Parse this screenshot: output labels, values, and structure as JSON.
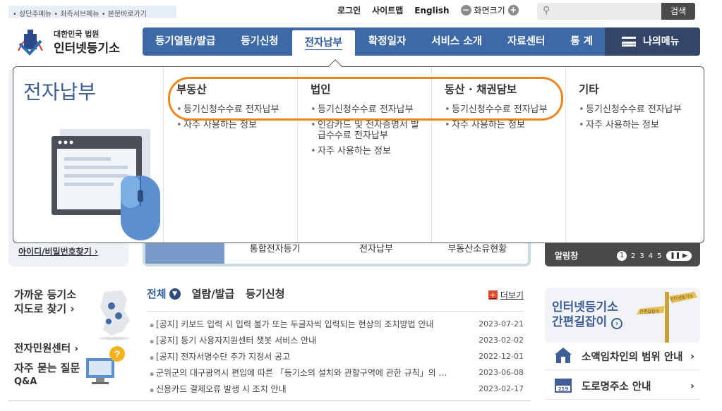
{
  "skip_links": "• 상단주메뉴  • 좌측서브메뉴  • 본문바로가기",
  "util": {
    "login": "로그인",
    "sitemap": "사이트맵",
    "english": "English",
    "zoom_label": "화면크기",
    "minus": "−",
    "plus": "+"
  },
  "search": {
    "button": "검색"
  },
  "logo": {
    "line1": "대한민국 법원",
    "line2": "인터넷등기소"
  },
  "nav": {
    "items": [
      "등기열람/발급",
      "등기신청",
      "전자납부",
      "확정일자",
      "서비스 소개",
      "자료센터",
      "통 계"
    ],
    "my_menu": "나의메뉴"
  },
  "panel": {
    "title": "전자납부",
    "cols": [
      {
        "head": "부동산",
        "items": [
          "등기신청수수료 전자납부",
          "자주 사용하는 정보"
        ]
      },
      {
        "head": "법인",
        "items": [
          "등기신청수수료 전자납부",
          "인감카드 및 전자증명서 발급수수료 전자납부",
          "자주 사용하는 정보"
        ]
      },
      {
        "head": "동산 · 채권담보",
        "items": [
          "등기신청수수료 전자납부",
          "자주 사용하는 정보"
        ]
      },
      {
        "head": "기타",
        "items": [
          "등기신청수수료 전자납부",
          "자주 사용하는 정보"
        ]
      }
    ]
  },
  "under": {
    "find_id": "아이디/비밀번호찾기 ›"
  },
  "midbox": {
    "tabs": [
      "통합전자등기",
      "전자납부",
      "부동산소유현황"
    ]
  },
  "notice": {
    "title": "알림창",
    "pages": [
      "1",
      "2",
      "3",
      "4",
      "5"
    ]
  },
  "near": {
    "line1": "가까운 등기소",
    "line2": "지도로 찾기 ›"
  },
  "cc": {
    "line1": "전자민원센터 ›",
    "faq": "자주 묻는 질문",
    "qa": "Q&A"
  },
  "news": {
    "tabs": [
      "전체",
      "열람/발급",
      "등기신청"
    ],
    "more": "더보기",
    "items": [
      {
        "title": "[공지] 키보드 입력 시 입력 불가 또는 두글자씩 입력되는 현상의 조치방법 안내",
        "date": "2023-07-21"
      },
      {
        "title": "[공지] 등기 사용자지원센터 챗봇 서비스 안내",
        "date": "2023-02-02"
      },
      {
        "title": "[공지] 전자서명수단 추가 지정서 공고",
        "date": "2022-12-01"
      },
      {
        "title": "군위군의 대구광역시 편입에 따른 「등기소의 설치와 관할구역에 관한 규칙」의 …",
        "date": "2023-06-08"
      },
      {
        "title": "신용카드 결제오류 발생 시 조치 안내",
        "date": "2023-02-17"
      }
    ]
  },
  "right": {
    "easy1": "인터넷등기소",
    "easy2": "간편길잡이",
    "link1": "소액임차인의 범위 안내",
    "link2": "도로명주소 안내",
    "chev": "›",
    "addr_badge": "219",
    "sign_text1": "인터넷등기소",
    "sign_text2": "간편길잡이"
  }
}
